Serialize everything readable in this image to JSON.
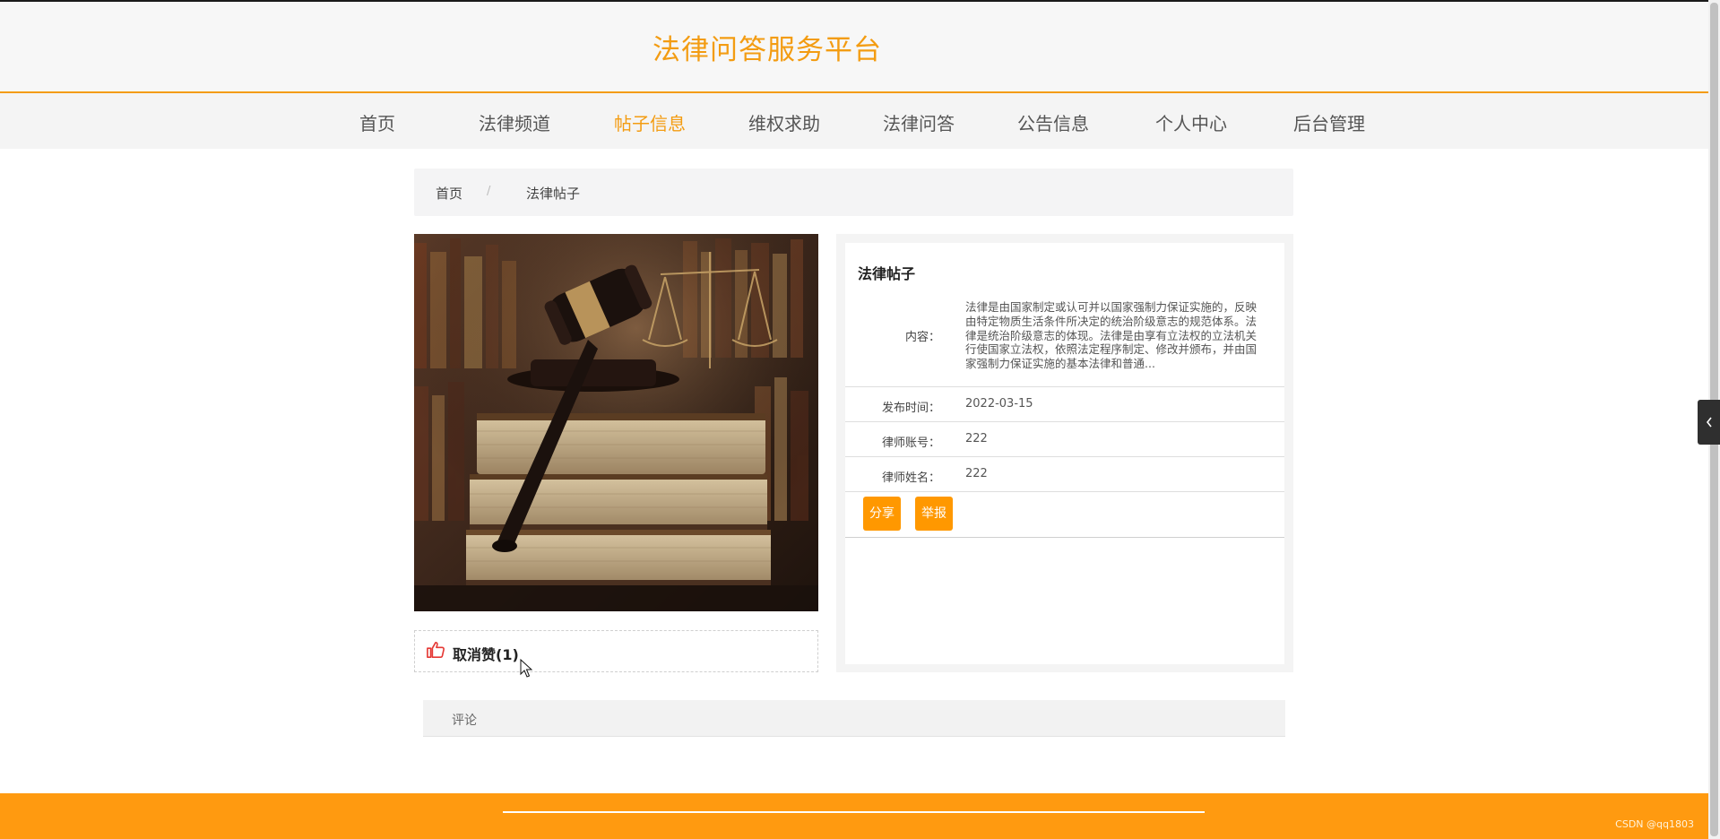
{
  "header": {
    "site_title": "法律问答服务平台"
  },
  "nav": {
    "items": [
      {
        "label": "首页",
        "active": false
      },
      {
        "label": "法律频道",
        "active": false
      },
      {
        "label": "帖子信息",
        "active": true
      },
      {
        "label": "维权求助",
        "active": false
      },
      {
        "label": "法律问答",
        "active": false
      },
      {
        "label": "公告信息",
        "active": false
      },
      {
        "label": "个人中心",
        "active": false
      },
      {
        "label": "后台管理",
        "active": false
      }
    ]
  },
  "breadcrumb": {
    "home": "首页",
    "separator": "/",
    "current": "法律帖子"
  },
  "like": {
    "icon": "thumbs-up-icon",
    "label": "取消赞(1)",
    "color": "#e53935"
  },
  "detail": {
    "title": "法律帖子",
    "content_label": "内容：",
    "content": "法律是由国家制定或认可并以国家强制力保证实施的，反映由特定物质生活条件所决定的统治阶级意志的规范体系。法律是统治阶级意志的体现。法律是由享有立法权的立法机关行使国家立法权，依照法定程序制定、修改并颁布，并由国家强制力保证实施的基本法律和普通...",
    "publish_time_label": "发布时间：",
    "publish_time": "2022-03-15",
    "lawyer_account_label": "律师账号：",
    "lawyer_account": "222",
    "lawyer_name_label": "律师姓名：",
    "lawyer_name": "222",
    "share_button": "分享",
    "report_button": "举报"
  },
  "comments": {
    "label": "评论"
  },
  "footer": {
    "watermark": "CSDN @qq1803"
  },
  "side_handle": {
    "icon": "chevron-left-icon"
  },
  "colors": {
    "accent": "#f39c12",
    "button": "#ff9800",
    "footer": "#ff9a10"
  }
}
